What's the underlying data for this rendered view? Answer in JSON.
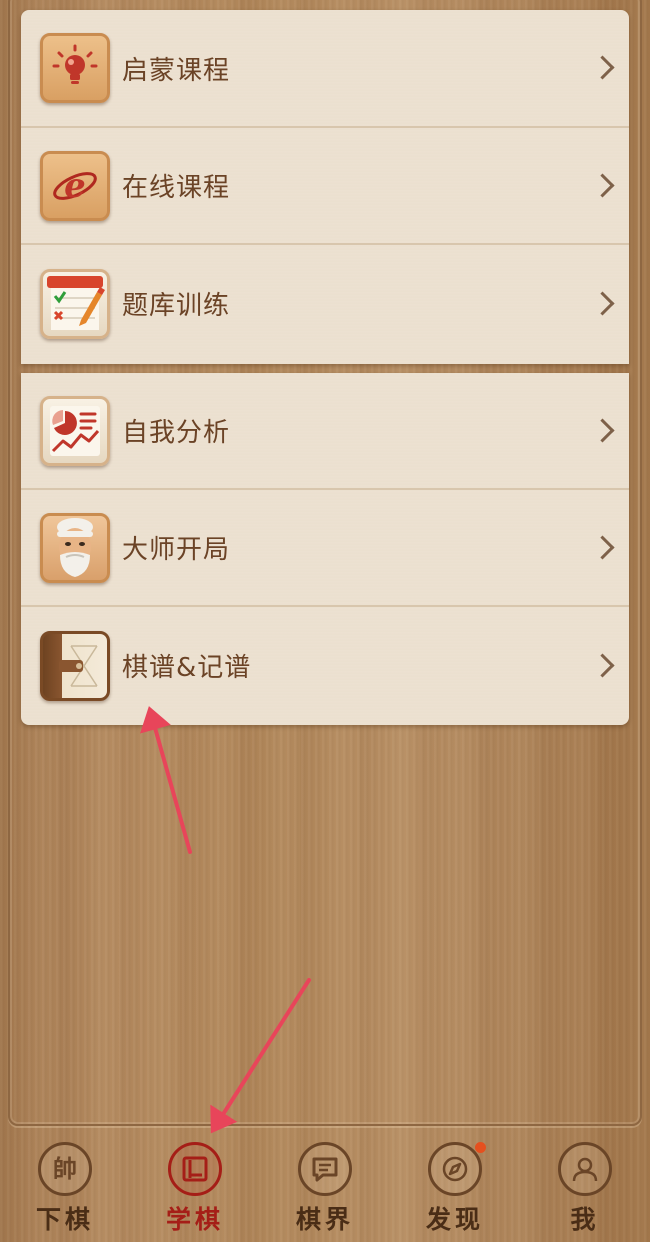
{
  "menu": {
    "group_1": [
      {
        "label": "启蒙课程",
        "icon": "lightbulb-icon"
      },
      {
        "label": "在线课程",
        "icon": "browser-e-icon"
      },
      {
        "label": "题库训练",
        "icon": "checklist-pencil-icon"
      }
    ],
    "group_2": [
      {
        "label": "自我分析",
        "icon": "analysis-chart-icon"
      },
      {
        "label": "大师开局",
        "icon": "master-avatar-icon"
      },
      {
        "label": "棋谱&记谱",
        "icon": "notebook-icon"
      }
    ]
  },
  "tabbar": {
    "tabs": [
      {
        "label": "下棋",
        "glyph": "帥",
        "icon": "chess-piece-icon"
      },
      {
        "label": "学棋",
        "glyph": "",
        "icon": "book-icon",
        "active": true
      },
      {
        "label": "棋界",
        "glyph": "",
        "icon": "chat-bubble-icon"
      },
      {
        "label": "发现",
        "glyph": "",
        "icon": "compass-icon",
        "badge": true
      },
      {
        "label": "我",
        "glyph": "",
        "icon": "user-profile-icon"
      }
    ]
  },
  "colors": {
    "card_background": "#ede2d2",
    "label_text": "#6b4326",
    "tab_active": "#a51e17",
    "tab_inactive": "#4a2d16",
    "badge": "#e5501e",
    "annotation_arrow": "#e8455a"
  }
}
